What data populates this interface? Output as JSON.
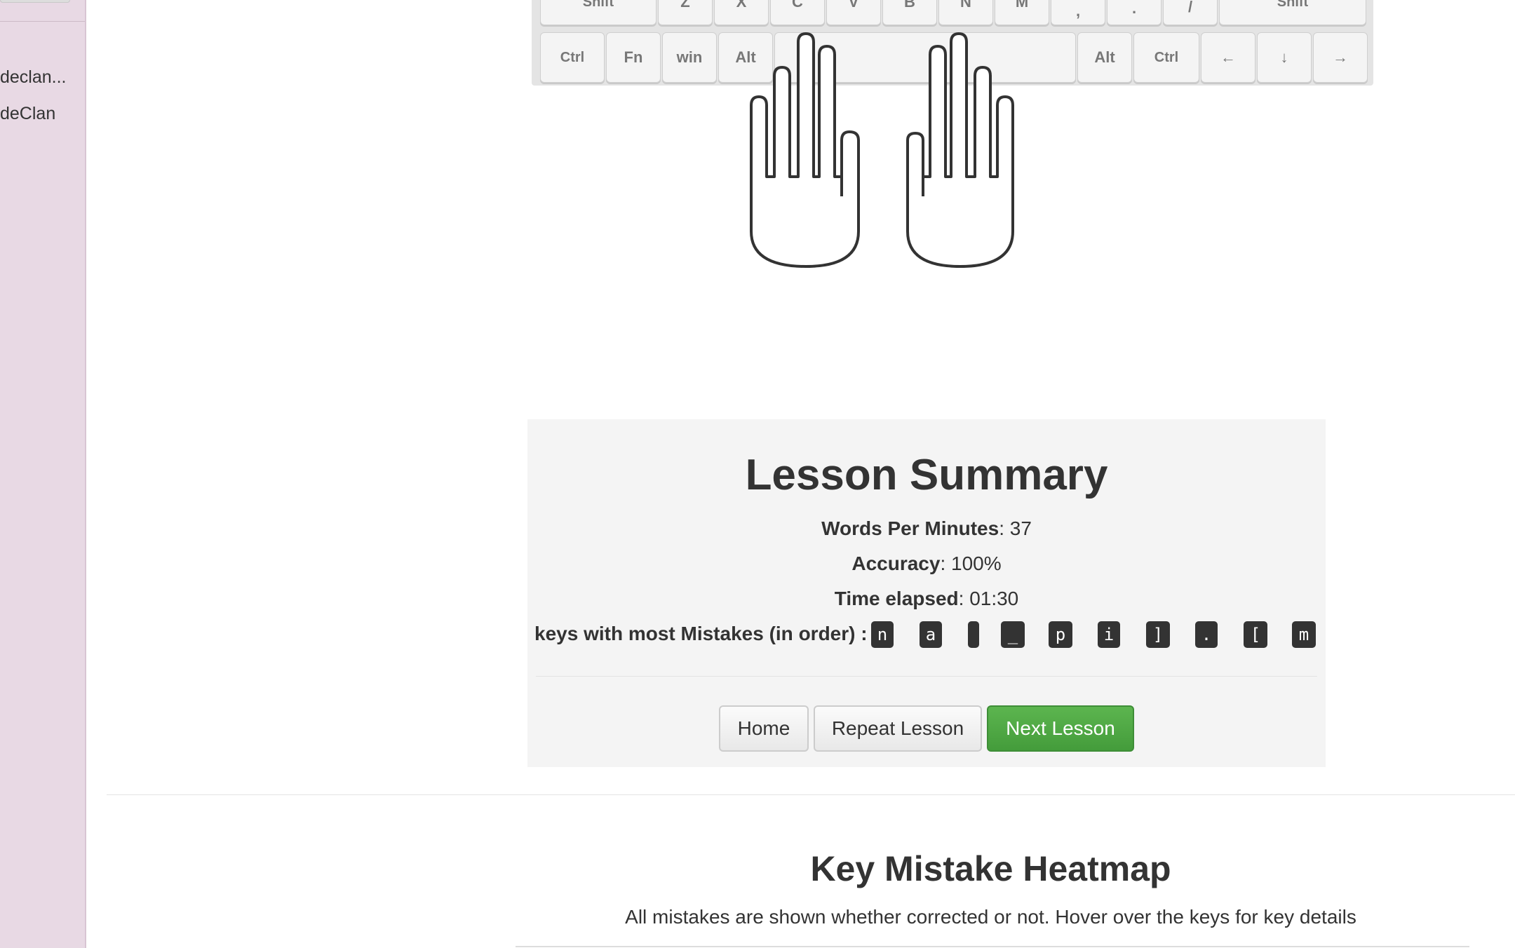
{
  "sidebar": {
    "items": [
      {
        "label": "declan..."
      },
      {
        "label": "deClan"
      }
    ]
  },
  "keyboard": {
    "row_top": [
      "Shift",
      "Z",
      "X",
      "C",
      "V",
      "B",
      "N",
      "M",
      ",",
      ".",
      "/",
      "Shift"
    ],
    "row_bottom": [
      "Ctrl",
      "Fn",
      "win",
      "Alt",
      "",
      "Alt",
      "Ctrl",
      "←",
      "↓",
      "→"
    ]
  },
  "summary": {
    "title": "Lesson Summary",
    "wpm_label": "Words Per Minutes",
    "wpm_value": "37",
    "accuracy_label": "Accuracy",
    "accuracy_value": "100%",
    "time_label": "Time elapsed",
    "time_value": "01:30",
    "mistakes_label": "keys with most Mistakes (in order) :",
    "mistake_keys": [
      "n",
      "a",
      " ",
      "_",
      "p",
      "i",
      "]",
      ".",
      "[",
      "m"
    ]
  },
  "buttons": {
    "home": "Home",
    "repeat": "Repeat Lesson",
    "next": "Next Lesson"
  },
  "heatmap": {
    "title": "Key Mistake Heatmap",
    "subtitle": "All mistakes are shown whether corrected or not. Hover over the keys for key details"
  },
  "colors": {
    "sidebar_bg": "#e8d9e4",
    "panel_bg": "#f4f4f4",
    "primary_button": "#4ca344",
    "kbd_bg": "#333333"
  }
}
